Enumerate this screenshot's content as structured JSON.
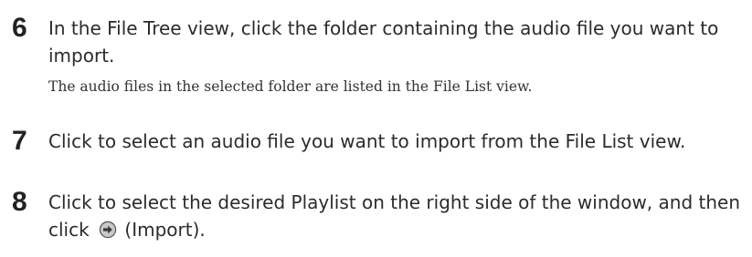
{
  "steps": [
    {
      "number": "6",
      "text": "In the File Tree view, click the folder containing the audio file you want to import.",
      "note": "The audio files in the selected folder are listed in the File List view."
    },
    {
      "number": "7",
      "text": "Click to select an audio file you want to import from the File List view."
    },
    {
      "number": "8",
      "text_before_icon": "Click to select the desired Playlist on the right side of the window, and then click",
      "icon": "import-arrow-icon",
      "text_after_icon": "(Import)."
    }
  ],
  "colors": {
    "text": "#2b2b2b",
    "icon_fill": "#c9c9c9",
    "icon_stroke": "#555555"
  }
}
